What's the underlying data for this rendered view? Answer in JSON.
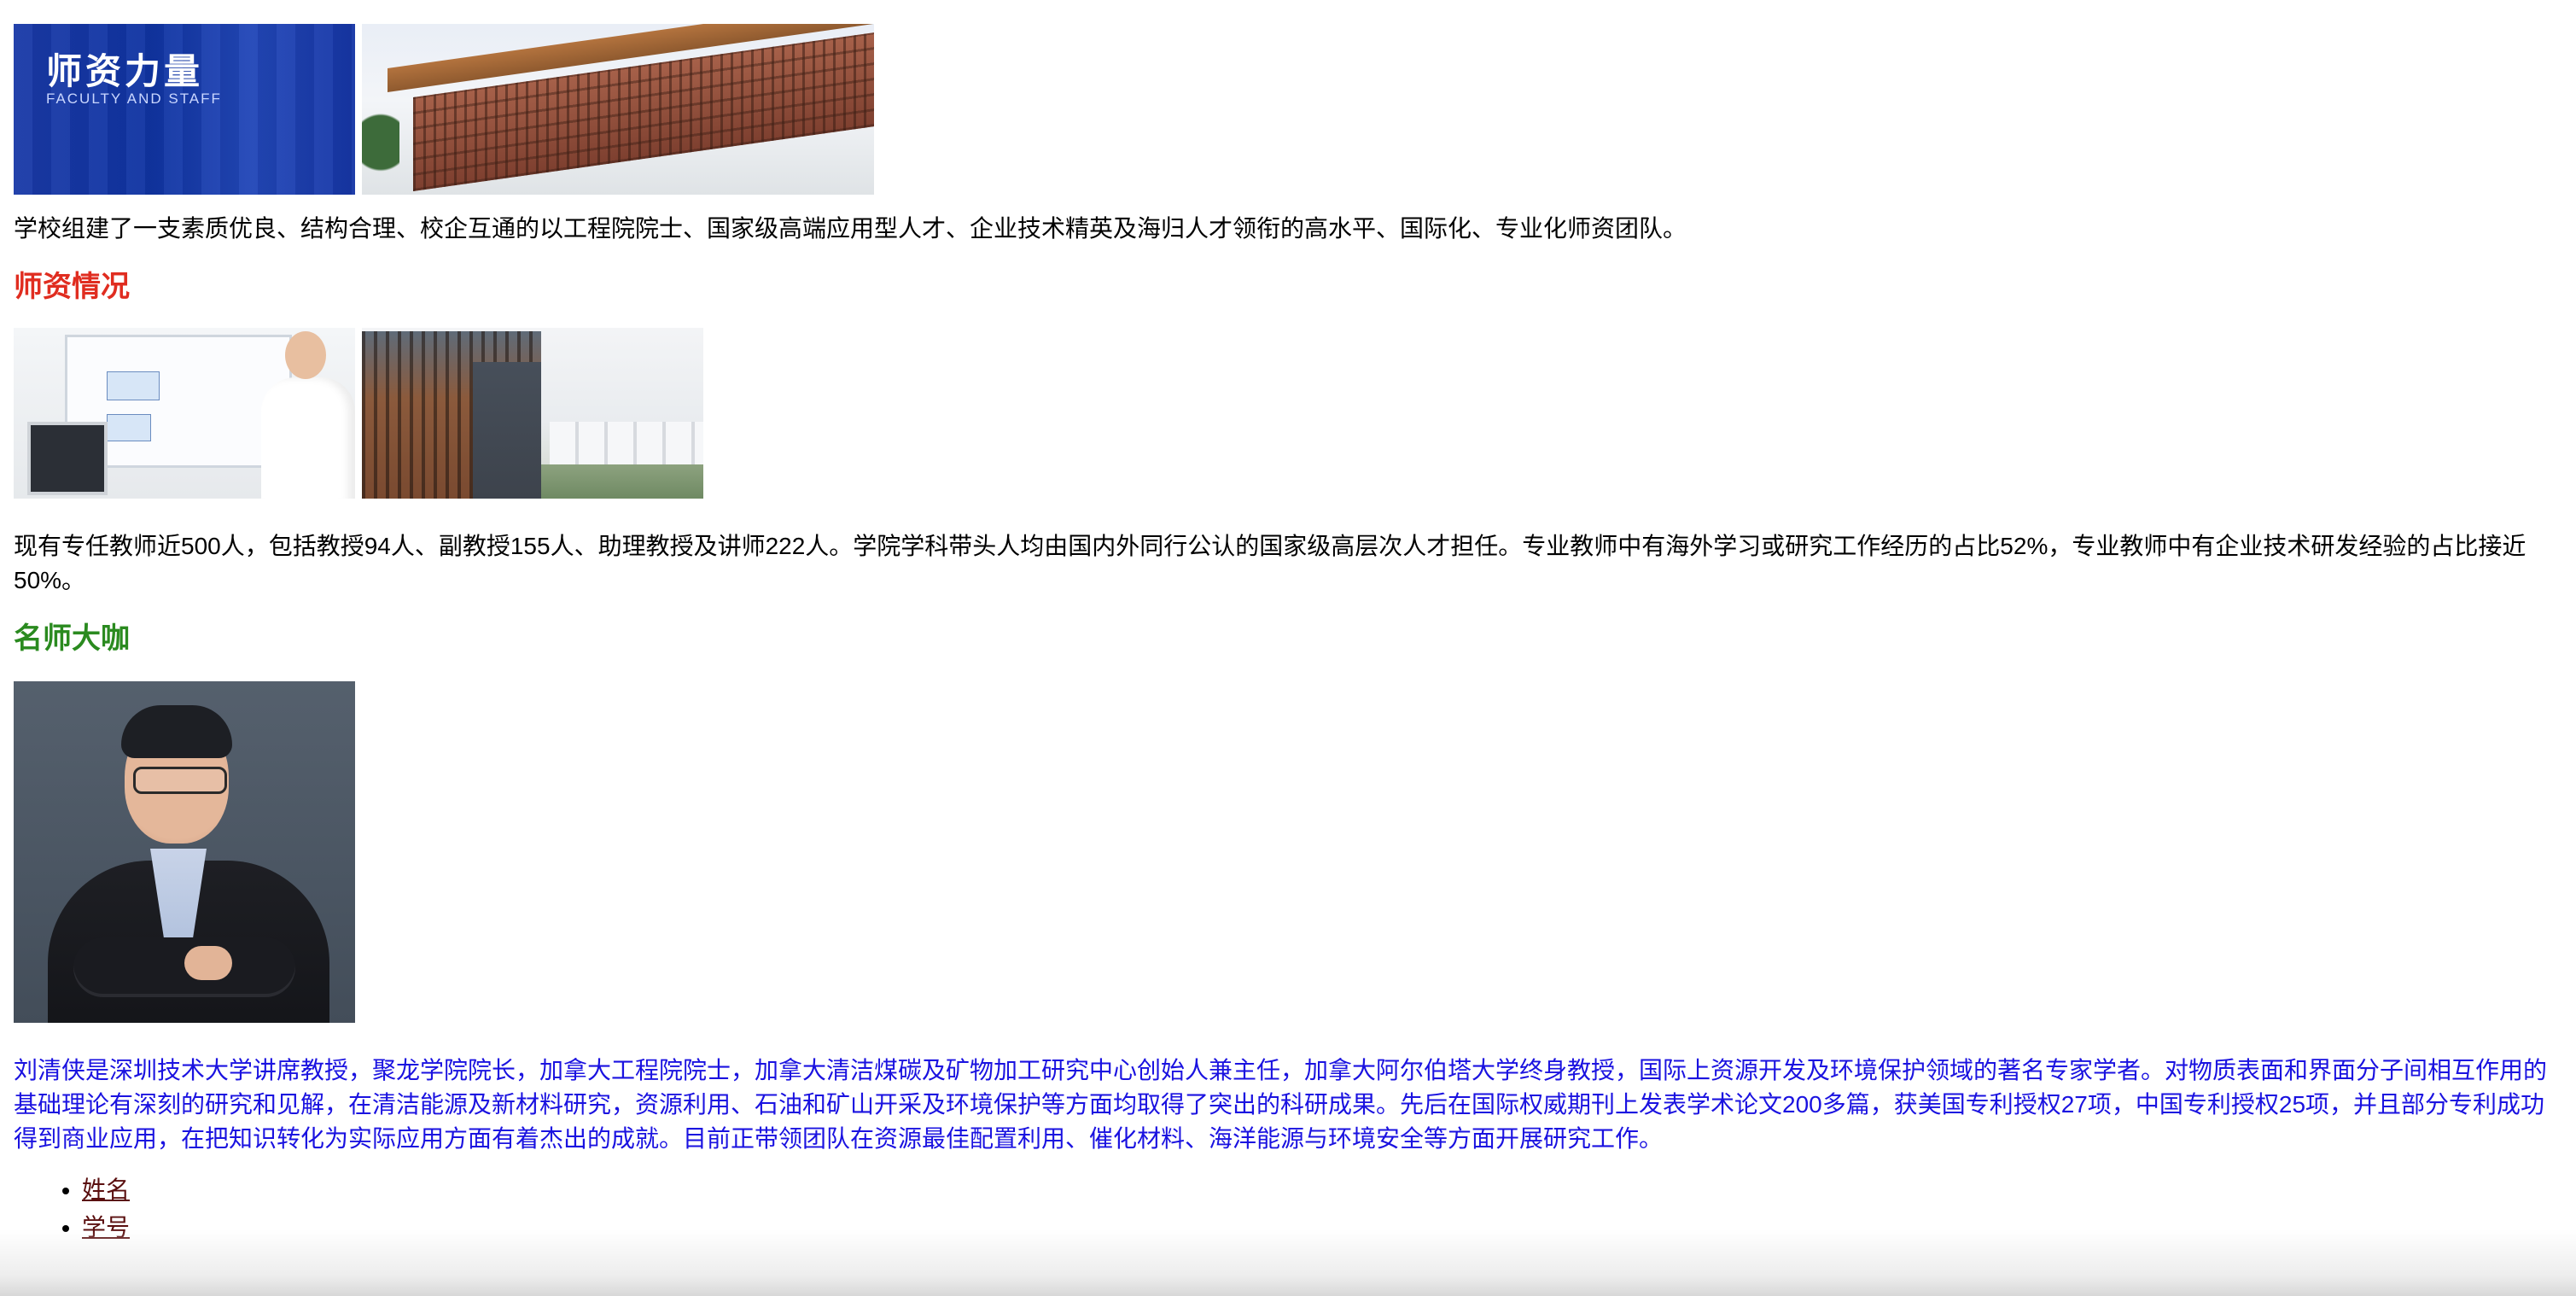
{
  "banner": {
    "title": "师资力量",
    "subtitle": "FACULTY AND STAFF"
  },
  "intro": "学校组建了一支素质优良、结构合理、校企互通的以工程院院士、国家级高端应用型人才、企业技术精英及海归人才领衔的高水平、国际化、专业化师资团队。",
  "faculty_section": {
    "heading": "师资情况",
    "body": "现有专任教师近500人，包括教授94人、副教授155人、助理教授及讲师222人。学院学科带头人均由国内外同行公认的国家级高层次人才担任。专业教师中有海外学习或研究工作经历的占比52%，专业教师中有企业技术研发经验的占比接近50%。"
  },
  "famous_section": {
    "heading": "名师大咖",
    "body": "刘清侠是深圳技术大学讲席教授，聚龙学院院长，加拿大工程院院士，加拿大清洁煤碳及矿物加工研究中心创始人兼主任，加拿大阿尔伯塔大学终身教授，国际上资源开发及环境保护领域的著名专家学者。对物质表面和界面分子间相互作用的基础理论有深刻的研究和见解，在清洁能源及新材料研究，资源利用、石油和矿山开采及环境保护等方面均取得了突出的科研成果。先后在国际权威期刊上发表学术论文200多篇，获美国专利授权27项，中国专利授权25项，并且部分专利成功得到商业应用，在把知识转化为实际应用方面有着杰出的成就。目前正带领团队在资源最佳配置利用、催化材料、海洋能源与环境安全等方面开展研究工作。"
  },
  "links": [
    {
      "label": "姓名"
    },
    {
      "label": "学号"
    }
  ],
  "colors": {
    "heading_red": "#e02d20",
    "heading_green": "#2a8a1f",
    "blue_text": "#1a12e0",
    "link": "#5a0f0f",
    "banner_blue": "#1034a2"
  }
}
